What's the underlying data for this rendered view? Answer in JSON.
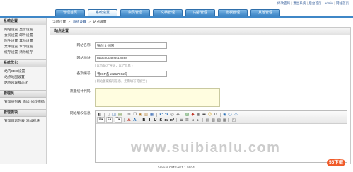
{
  "header": {
    "top_links": [
      "修改密码",
      "退出系统",
      "后台首页",
      "admin",
      "网站首页"
    ],
    "separator": "|"
  },
  "nav": {
    "tabs": [
      {
        "label": "管理首页",
        "active": false
      },
      {
        "label": "系统设置",
        "active": true
      },
      {
        "label": "会员管理",
        "active": false
      },
      {
        "label": "文档管理",
        "active": false
      },
      {
        "label": "内容管理",
        "active": false
      },
      {
        "label": "模板管理",
        "active": false
      },
      {
        "label": "其他管理",
        "active": false
      }
    ]
  },
  "sidebar": {
    "sections": [
      {
        "title": "系统设置",
        "rows": [
          [
            "网站设置",
            "显示设置"
          ],
          [
            "会员设置",
            "邮件设置"
          ],
          [
            "附件设置",
            "其他设置"
          ],
          [
            "文件设置",
            "水印设置"
          ],
          [
            "缓存设置",
            "清除缓存"
          ]
        ]
      },
      {
        "title": "系统优化",
        "rows": [
          [
            "站内SEO设置"
          ],
          [
            "站点地图设置"
          ],
          [
            "站点内容静态化"
          ]
        ]
      },
      {
        "title": "管理员",
        "rows": [
          [
            "管理员列表",
            "添加",
            "修改密码"
          ]
        ]
      },
      {
        "title": "管理模块",
        "rows": [
          [
            "管理日志列表",
            "添加模块"
          ]
        ]
      }
    ]
  },
  "breadcrumb": {
    "prefix": "当前位置",
    "separator": ">",
    "items": [
      "系统设置",
      "站点设置"
    ]
  },
  "panel": {
    "title": "站点设置"
  },
  "form": {
    "site_name": {
      "label": "网站名称:",
      "value": "锐创文化网"
    },
    "site_url": {
      "label": "网站地址:",
      "value": "http://localhost:8888",
      "hint": "( 以\"http://\"开头，以\"/\"结尾 )"
    },
    "icp": {
      "label": "备案编号:",
      "value": "粤ICP备10217062号",
      "hint": "( 网站备案编号信息，无需填写可留空 )"
    },
    "stats_code": {
      "label": "流量统计代码:"
    },
    "copyright": {
      "label": "网站版权信息:"
    }
  },
  "editor": {
    "toolbar": {
      "row1": [
        {
          "icon": "source-icon",
          "glyph": "◧",
          "color": "#444444"
        },
        {
          "icon": "new-page-icon",
          "glyph": "▯",
          "color": "#777777"
        },
        {
          "icon": "preview-icon",
          "glyph": "◫",
          "color": "#3a6fb0"
        },
        {
          "icon": "template-icon",
          "glyph": "▤",
          "color": "#6a8f3a"
        },
        {
          "icon": "cut-icon",
          "glyph": "✂",
          "color": "#555555"
        },
        {
          "icon": "copy-icon",
          "glyph": "❐",
          "color": "#555555"
        },
        {
          "icon": "paste-icon",
          "glyph": "▣",
          "color": "#b07a2a"
        },
        {
          "icon": "paste-text-icon",
          "glyph": "▥",
          "color": "#b07a2a"
        },
        {
          "icon": "paste-word-icon",
          "glyph": "▦",
          "color": "#2a5fb0"
        },
        {
          "icon": "undo-icon",
          "glyph": "↶",
          "color": "#2a6fb6"
        },
        {
          "icon": "redo-icon",
          "glyph": "↷",
          "color": "#2a6fb6"
        },
        {
          "icon": "find-icon",
          "glyph": "◎",
          "color": "#555555"
        },
        {
          "icon": "replace-icon",
          "glyph": "◈",
          "color": "#555555"
        },
        {
          "icon": "image-icon",
          "glyph": "▨",
          "color": "#3c8f3c"
        },
        {
          "icon": "flash-icon",
          "glyph": "◆",
          "color": "#c0392b"
        },
        {
          "icon": "table-icon",
          "glyph": "▦",
          "color": "#555555"
        },
        {
          "icon": "horizontal-rule-icon",
          "glyph": "▬",
          "color": "#555555"
        },
        {
          "icon": "smiley-icon",
          "glyph": "☺",
          "color": "#d4a017"
        },
        {
          "icon": "special-char-icon",
          "glyph": "Ω",
          "color": "#555555"
        },
        {
          "icon": "link-icon",
          "glyph": "◉",
          "color": "#2a6fb6"
        },
        {
          "icon": "unlink-icon",
          "glyph": "○",
          "color": "#2a6fb6"
        },
        {
          "icon": "anchor-icon",
          "glyph": "◇",
          "color": "#2a6fb6"
        }
      ],
      "row2": [
        {
          "icon": "format-dropdown",
          "glyph": "H▾",
          "color": "#333333"
        },
        {
          "icon": "font-dropdown",
          "glyph": "F▾",
          "color": "#333333"
        },
        {
          "icon": "size-dropdown",
          "glyph": "T▾",
          "color": "#333333"
        },
        {
          "icon": "text-color-icon",
          "glyph": "A",
          "color": "#c0392b"
        },
        {
          "icon": "bg-color-icon",
          "glyph": "A",
          "color": "#2a6fb6"
        },
        {
          "icon": "bold-icon",
          "glyph": "B",
          "color": "#222222"
        },
        {
          "icon": "italic-icon",
          "glyph": "I",
          "color": "#222222"
        },
        {
          "icon": "underline-icon",
          "glyph": "U",
          "color": "#222222"
        },
        {
          "icon": "strike-icon",
          "glyph": "S",
          "color": "#222222"
        },
        {
          "icon": "subscript-icon",
          "glyph": "x₂",
          "color": "#222222"
        },
        {
          "icon": "superscript-icon",
          "glyph": "x²",
          "color": "#222222"
        },
        {
          "icon": "numbered-list-icon",
          "glyph": "≡",
          "color": "#555555"
        },
        {
          "icon": "bullet-list-icon",
          "glyph": "☰",
          "color": "#555555"
        },
        {
          "icon": "outdent-icon",
          "glyph": "◂",
          "color": "#555555"
        },
        {
          "icon": "indent-icon",
          "glyph": "▸",
          "color": "#555555"
        },
        {
          "icon": "align-left-icon",
          "glyph": "▤",
          "color": "#555555"
        },
        {
          "icon": "align-center-icon",
          "glyph": "▥",
          "color": "#555555"
        },
        {
          "icon": "align-right-icon",
          "glyph": "▧",
          "color": "#555555"
        },
        {
          "icon": "justify-icon",
          "glyph": "▦",
          "color": "#555555"
        },
        {
          "icon": "maximize-icon",
          "glyph": "◰",
          "color": "#555555"
        }
      ]
    }
  },
  "footer": {
    "text": "Venus CMSver1.1.5034"
  },
  "watermark": {
    "text": "www.suibianlu.com",
    "logo_text": "55下载"
  },
  "colors": {
    "accent": "#3f87c7",
    "textarea_bg": "#fffde0"
  }
}
